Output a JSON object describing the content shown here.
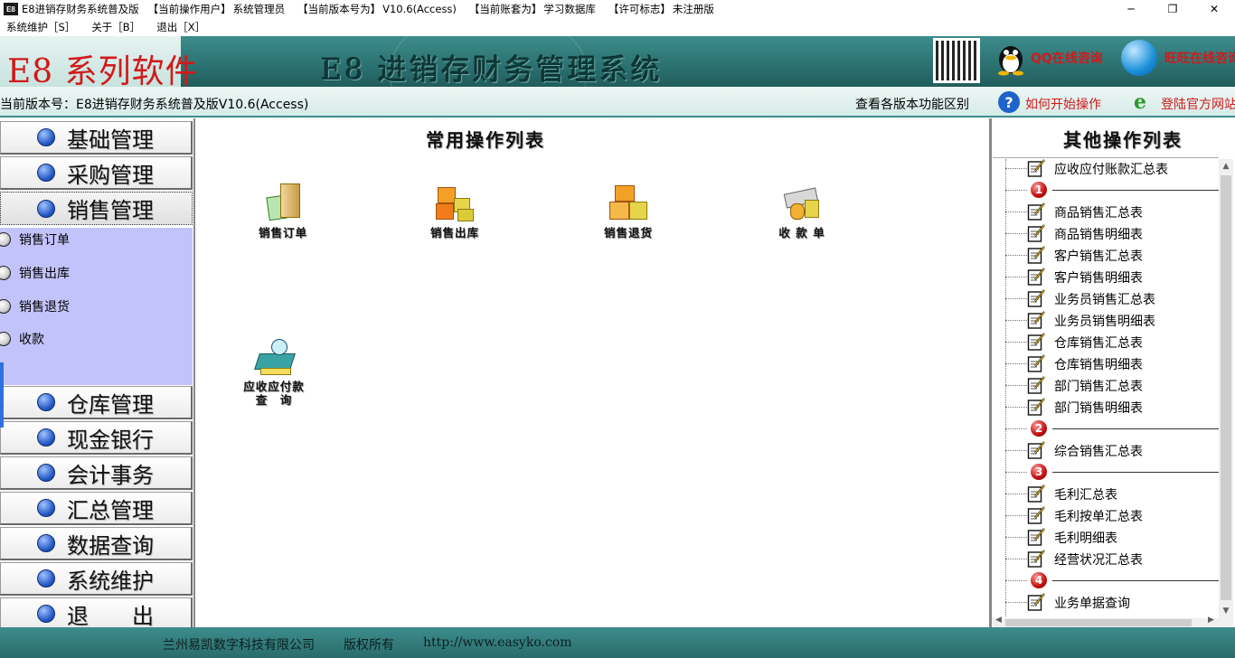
{
  "window": {
    "app_icon_text": "E8",
    "title": "E8进销存财务系统普及版",
    "current_user_label": "【当前操作用户】",
    "current_user": "系统管理员",
    "version_label": "【当前版本号为】",
    "version": "V10.6(Access)",
    "account_label": "【当前账套为】",
    "account": "学习数据库",
    "license_label": "【许可标志】",
    "license": "未注册版",
    "min_icon": "─",
    "restore_icon": "❐",
    "close_icon": "✕"
  },
  "menu": [
    "系统维护［S］",
    "关于［B］",
    "退出［X］"
  ],
  "banner": {
    "brand": "E8 系列软件",
    "system_name": "E8 进销存财务管理系统",
    "qq_text": "QQ在线咨询",
    "wangwang_text": "旺旺在线咨询"
  },
  "version_bar": {
    "current_version": "当前版本号：E8进销存财务系统普及版V10.6(Access)",
    "compare_link": "查看各版本功能区别",
    "howto_link": "如何开始操作",
    "official_link": "登陆官方网站"
  },
  "nav": [
    {
      "label": "基础管理"
    },
    {
      "label": "采购管理"
    },
    {
      "label": "销售管理"
    },
    {
      "label": "仓库管理"
    },
    {
      "label": "现金银行"
    },
    {
      "label": "会计事务"
    },
    {
      "label": "汇总管理"
    },
    {
      "label": "数据查询"
    },
    {
      "label": "系统维护"
    },
    {
      "label": "退　　出"
    }
  ],
  "sub_nav": [
    {
      "label": "销售订单"
    },
    {
      "label": "销售出库"
    },
    {
      "label": "销售退货"
    },
    {
      "label": "收款"
    }
  ],
  "main": {
    "title": "常用操作列表",
    "operations": [
      {
        "label": "销售订单",
        "icon": "sales-order-icon"
      },
      {
        "label": "销售出库",
        "icon": "sales-outbound-icon"
      },
      {
        "label": "销售退货",
        "icon": "sales-return-icon"
      },
      {
        "label": "收 款 单",
        "icon": "receipt-icon"
      },
      {
        "label": "应收应付款",
        "label2": "查　询",
        "icon": "receivable-query-icon"
      }
    ]
  },
  "right": {
    "title": "其他操作列表",
    "items": [
      {
        "type": "report",
        "label": "应收应付账款汇总表"
      },
      {
        "type": "sep",
        "num": "1"
      },
      {
        "type": "report",
        "label": "商品销售汇总表"
      },
      {
        "type": "report",
        "label": "商品销售明细表"
      },
      {
        "type": "report",
        "label": "客户销售汇总表"
      },
      {
        "type": "report",
        "label": "客户销售明细表"
      },
      {
        "type": "report",
        "label": "业务员销售汇总表"
      },
      {
        "type": "report",
        "label": "业务员销售明细表"
      },
      {
        "type": "report",
        "label": "仓库销售汇总表"
      },
      {
        "type": "report",
        "label": "仓库销售明细表"
      },
      {
        "type": "report",
        "label": "部门销售汇总表"
      },
      {
        "type": "report",
        "label": "部门销售明细表"
      },
      {
        "type": "sep",
        "num": "2"
      },
      {
        "type": "report",
        "label": "综合销售汇总表"
      },
      {
        "type": "sep",
        "num": "3"
      },
      {
        "type": "report",
        "label": "毛利汇总表"
      },
      {
        "type": "report",
        "label": "毛利按单汇总表"
      },
      {
        "type": "report",
        "label": "毛利明细表"
      },
      {
        "type": "report",
        "label": "经营状况汇总表"
      },
      {
        "type": "sep",
        "num": "4"
      },
      {
        "type": "report",
        "label": "业务单据查询"
      }
    ]
  },
  "footer": {
    "company": "兰州易凯数字科技有限公司",
    "rights": "版权所有",
    "url": "http://www.easyko.com"
  }
}
